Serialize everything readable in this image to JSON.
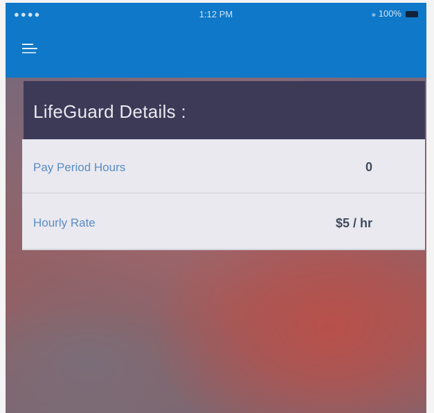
{
  "status_bar": {
    "signal": "●●●●",
    "time": "1:12 PM",
    "battery_text": "⁎ 100%"
  },
  "app_bar": {
    "menu_icon": "hamburger-menu-icon",
    "color": "#0f78c8"
  },
  "details": {
    "title": "LifeGuard Details :",
    "rows": [
      {
        "label": "Pay Period Hours",
        "value": "0"
      },
      {
        "label": "Hourly Rate",
        "value": "$5 / hr"
      }
    ]
  }
}
